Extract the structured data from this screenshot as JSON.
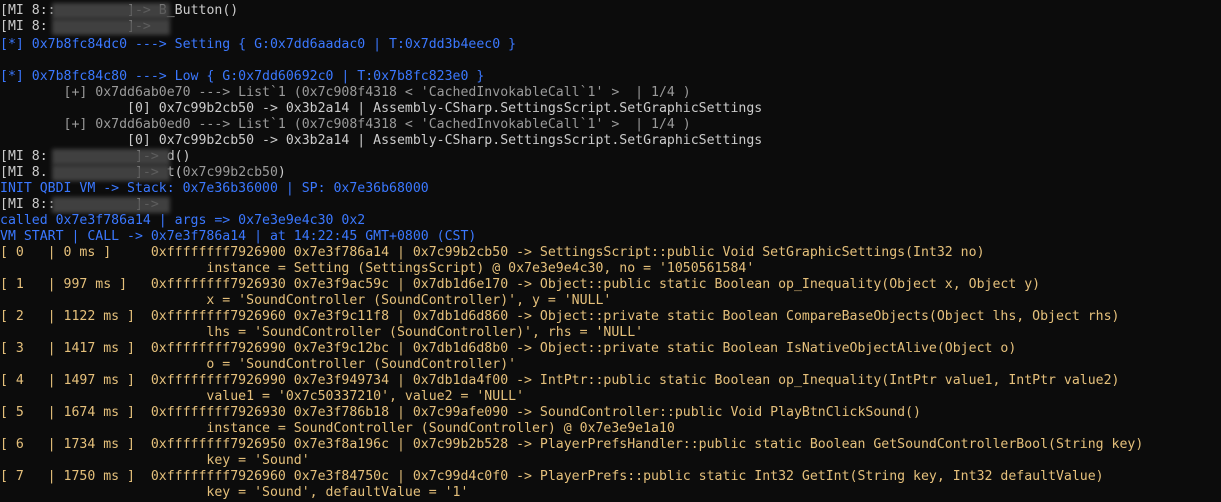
{
  "colors": {
    "default": "#cccccc",
    "blue": "#3b78ff",
    "blue_dim": "#2f5fc4",
    "gold": "#e5c07b",
    "gray": "#9a9a9a"
  },
  "lines": [
    {
      "t": 3,
      "segs": [
        {
          "c": "#cccccc",
          "s": "[MI 8::"
        },
        {
          "c": "#cccccc",
          "s": "         "
        },
        {
          "c": "#cccccc",
          "s": "]-> B_Button()"
        }
      ],
      "blur": true
    },
    {
      "t": 19,
      "segs": [
        {
          "c": "#cccccc",
          "s": "[MI 8:"
        },
        {
          "c": "#cccccc",
          "s": "          "
        },
        {
          "c": "#cccccc",
          "s": "]->"
        }
      ],
      "blur": true
    },
    {
      "t": 37,
      "segs": [
        {
          "c": "#3b78ff",
          "s": "[*] 0x7b8fc84dc0 ---> Setting { G:0x7dd6aadac0 | T:0x7dd3b4eec0 }"
        }
      ]
    },
    {
      "t": 69,
      "segs": [
        {
          "c": "#3b78ff",
          "s": "[*] 0x7b8fc84c80 ---> Low { G:0x7dd60692c0 | T:0x7b8fc823e0 }"
        }
      ]
    },
    {
      "t": 85,
      "segs": [
        {
          "c": "#9a9a9a",
          "s": "        [+] 0x7dd6ab0e70 ---> List`1 (0x7c908f4318 < 'CachedInvokableCall`1' >  | 1/4 )"
        }
      ]
    },
    {
      "t": 101,
      "segs": [
        {
          "c": "#cccccc",
          "s": "                [0] 0x7c99b2cb50 -> 0x3b2a14 | Assembly-CSharp.SettingsScript.SetGraphicSettings"
        }
      ]
    },
    {
      "t": 117,
      "segs": [
        {
          "c": "#9a9a9a",
          "s": "        [+] 0x7dd6ab0ed0 ---> List`1 (0x7c908f4318 < 'CachedInvokableCall`1' >  | 1/4 )"
        }
      ]
    },
    {
      "t": 133,
      "segs": [
        {
          "c": "#cccccc",
          "s": "                [0] 0x7c99b2cb50 -> 0x3b2a14 | Assembly-CSharp.SettingsScript.SetGraphicSettings"
        }
      ]
    },
    {
      "t": 149,
      "segs": [
        {
          "c": "#cccccc",
          "s": "[MI 8:"
        },
        {
          "c": "#cccccc",
          "s": "           "
        },
        {
          "c": "#cccccc",
          "s": "]-> d()"
        }
      ],
      "blur": true
    },
    {
      "t": 165,
      "segs": [
        {
          "c": "#cccccc",
          "s": "[MI 8."
        },
        {
          "c": "#cccccc",
          "s": "           "
        },
        {
          "c": "#cccccc",
          "s": "]-> t("
        },
        {
          "c": "#9a9a9a",
          "s": "0x7c99b2cb50"
        },
        {
          "c": "#cccccc",
          "s": ")"
        }
      ],
      "blur": true
    },
    {
      "t": 181,
      "segs": [
        {
          "c": "#3b78ff",
          "s": "INIT QBDI VM -> Stack: 0x7e36b36000 | SP: 0x7e36b68000"
        }
      ]
    },
    {
      "t": 197,
      "segs": [
        {
          "c": "#cccccc",
          "s": "[MI 8::"
        },
        {
          "c": "#cccccc",
          "s": "          "
        },
        {
          "c": "#cccccc",
          "s": "]->"
        }
      ],
      "blur": true
    },
    {
      "t": 213,
      "segs": [
        {
          "c": "#3b78ff",
          "s": "called 0x7e3f786a14 | args => 0x7e3e9e4c30 0x2"
        }
      ]
    },
    {
      "t": 229,
      "segs": [
        {
          "c": "#3b78ff",
          "s": "VM START | CALL -> 0x7e3f786a14 | at 14:22:45 GMT+0800 (CST)"
        }
      ]
    },
    {
      "t": 245,
      "segs": [
        {
          "c": "#e5c07b",
          "s": "[ 0   | 0 ms ]     0xffffffff7926900 0x7e3f786a14 | 0x7c99b2cb50 -> SettingsScript::public Void SetGraphicSettings(Int32 no)"
        }
      ]
    },
    {
      "t": 261,
      "segs": [
        {
          "c": "#e5c07b",
          "s": "                          instance = Setting (SettingsScript) @ 0x7e3e9e4c30, no = '1050561584'"
        }
      ]
    },
    {
      "t": 277,
      "segs": [
        {
          "c": "#e5c07b",
          "s": "[ 1   | 997 ms ]   0xffffffff7926930 0x7e3f9ac59c | 0x7db1d6e170 -> Object::public static Boolean op_Inequality(Object x, Object y)"
        }
      ]
    },
    {
      "t": 293,
      "segs": [
        {
          "c": "#e5c07b",
          "s": "                          x = 'SoundController (SoundController)', y = 'NULL'"
        }
      ]
    },
    {
      "t": 309,
      "segs": [
        {
          "c": "#e5c07b",
          "s": "[ 2   | 1122 ms ]  0xffffffff7926960 0x7e3f9c11f8 | 0x7db1d6d860 -> Object::private static Boolean CompareBaseObjects(Object lhs, Object rhs)"
        }
      ]
    },
    {
      "t": 325,
      "segs": [
        {
          "c": "#e5c07b",
          "s": "                          lhs = 'SoundController (SoundController)', rhs = 'NULL'"
        }
      ]
    },
    {
      "t": 341,
      "segs": [
        {
          "c": "#e5c07b",
          "s": "[ 3   | 1417 ms ]  0xffffffff7926990 0x7e3f9c12bc | 0x7db1d6d8b0 -> Object::private static Boolean IsNativeObjectAlive(Object o)"
        }
      ]
    },
    {
      "t": 357,
      "segs": [
        {
          "c": "#e5c07b",
          "s": "                          o = 'SoundController (SoundController)'"
        }
      ]
    },
    {
      "t": 373,
      "segs": [
        {
          "c": "#e5c07b",
          "s": "[ 4   | 1497 ms ]  0xffffffff7926990 0x7e3f949734 | 0x7db1da4f00 -> IntPtr::public static Boolean op_Inequality(IntPtr value1, IntPtr value2)"
        }
      ]
    },
    {
      "t": 389,
      "segs": [
        {
          "c": "#e5c07b",
          "s": "                          value1 = '0x7c50337210', value2 = 'NULL'"
        }
      ]
    },
    {
      "t": 405,
      "segs": [
        {
          "c": "#e5c07b",
          "s": "[ 5   | 1674 ms ]  0xffffffff7926930 0x7e3f786b18 | 0x7c99afe090 -> SoundController::public Void PlayBtnClickSound()"
        }
      ]
    },
    {
      "t": 421,
      "segs": [
        {
          "c": "#e5c07b",
          "s": "                          instance = SoundController (SoundController) @ 0x7e3e9e1a10"
        }
      ]
    },
    {
      "t": 437,
      "segs": [
        {
          "c": "#e5c07b",
          "s": "[ 6   | 1734 ms ]  0xffffffff7926950 0x7e3f8a196c | 0x7c99b2b528 -> PlayerPrefsHandler::public static Boolean GetSoundControllerBool(String key)"
        }
      ]
    },
    {
      "t": 453,
      "segs": [
        {
          "c": "#e5c07b",
          "s": "                          key = 'Sound'"
        }
      ]
    },
    {
      "t": 469,
      "segs": [
        {
          "c": "#e5c07b",
          "s": "[ 7   | 1750 ms ]  0xffffffff7926960 0x7e3f84750c | 0x7c99d4c0f0 -> PlayerPrefs::public static Int32 GetInt(String key, Int32 defaultValue)"
        }
      ]
    },
    {
      "t": 485,
      "segs": [
        {
          "c": "#e5c07b",
          "s": "                          key = 'Sound', defaultValue = '1'"
        }
      ]
    }
  ]
}
